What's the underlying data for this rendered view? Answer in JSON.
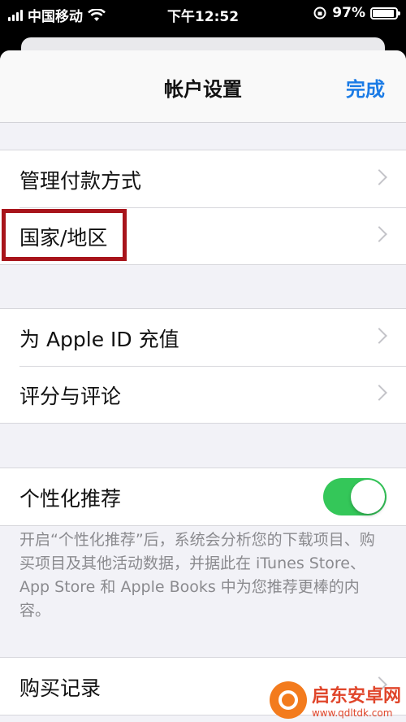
{
  "status_bar": {
    "carrier": "中国移动",
    "time": "下午12:52",
    "battery_percent": "97%"
  },
  "nav": {
    "title": "帐户设置",
    "done_label": "完成"
  },
  "groups": {
    "payment": [
      {
        "label": "管理付款方式"
      },
      {
        "label": "国家/地区"
      }
    ],
    "apple_id": [
      {
        "label": "为 Apple ID 充值"
      },
      {
        "label": "评分与评论"
      }
    ],
    "personalization": {
      "label": "个性化推荐",
      "toggle_on": true
    },
    "footnote": "开启“个性化推荐”后，系统会分析您的下载项目、购买项目及其他活动数据，并据此在 iTunes Store、App Store 和 Apple Books 中为您推荐更棒的内容。",
    "purchase": {
      "label": "购买记录"
    }
  },
  "watermark": {
    "title": "启东安卓网",
    "url": "www.qdltdk.com"
  },
  "colors": {
    "accent": "#1a7be6",
    "toggle_on": "#34c759",
    "highlight_box": "#a8141b"
  }
}
